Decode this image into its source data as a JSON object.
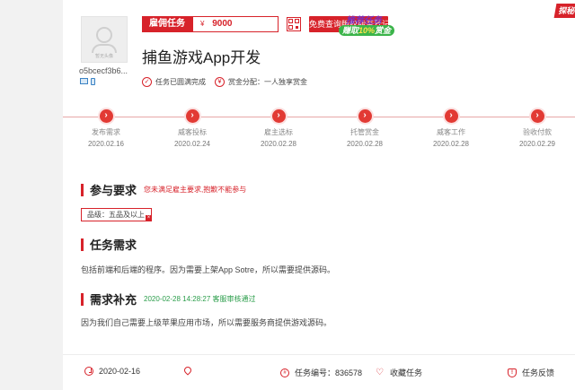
{
  "user": {
    "avatar_caption": "暂无头像",
    "name": "o5bcecf3b6..."
  },
  "task": {
    "type_label": "雇佣任务",
    "currency_symbol": "¥",
    "amount": "9000",
    "copyright_button": "免费查询版权能否登记",
    "title": "捕鱼游戏App开发",
    "status": "任务已圆满完成",
    "bounty_distribution": "赏金分配：一人独享赏金",
    "promo_line1": "推荐任务",
    "promo_line2_prefix": "赚取",
    "promo_line2_highlight": "10%",
    "promo_line2_suffix": "赏金",
    "ribbon_text": "探秘"
  },
  "timeline": [
    {
      "label": "发布需求",
      "date": "2020.02.16"
    },
    {
      "label": "威客投标",
      "date": "2020.02.24"
    },
    {
      "label": "雇主选标",
      "date": "2020.02.28"
    },
    {
      "label": "托管赏金",
      "date": "2020.02.28"
    },
    {
      "label": "威客工作",
      "date": "2020.02.28"
    },
    {
      "label": "验收付款",
      "date": "2020.02.29"
    }
  ],
  "participation": {
    "title": "参与要求",
    "note": "您未满足雇主要求,抱歉不能参与",
    "requirement": "品级：五品及以上"
  },
  "requirements": {
    "title": "任务需求",
    "text": "包括前端和后端的程序。因为需要上架App Sotre，所以需要提供源码。"
  },
  "supplement": {
    "title": "需求补充",
    "note": "2020-02-28 14:28:27 客服审核通过",
    "text": "因为我们自己需要上级苹果应用市场，所以需要服务商提供游戏源码。"
  },
  "footer": {
    "date": "2020-02-16",
    "task_number": "任务编号：836578",
    "favorite": "收藏任务",
    "feedback": "任务反馈"
  },
  "colors": {
    "accent": "#d7222a",
    "approved": "#2a9d4a"
  }
}
